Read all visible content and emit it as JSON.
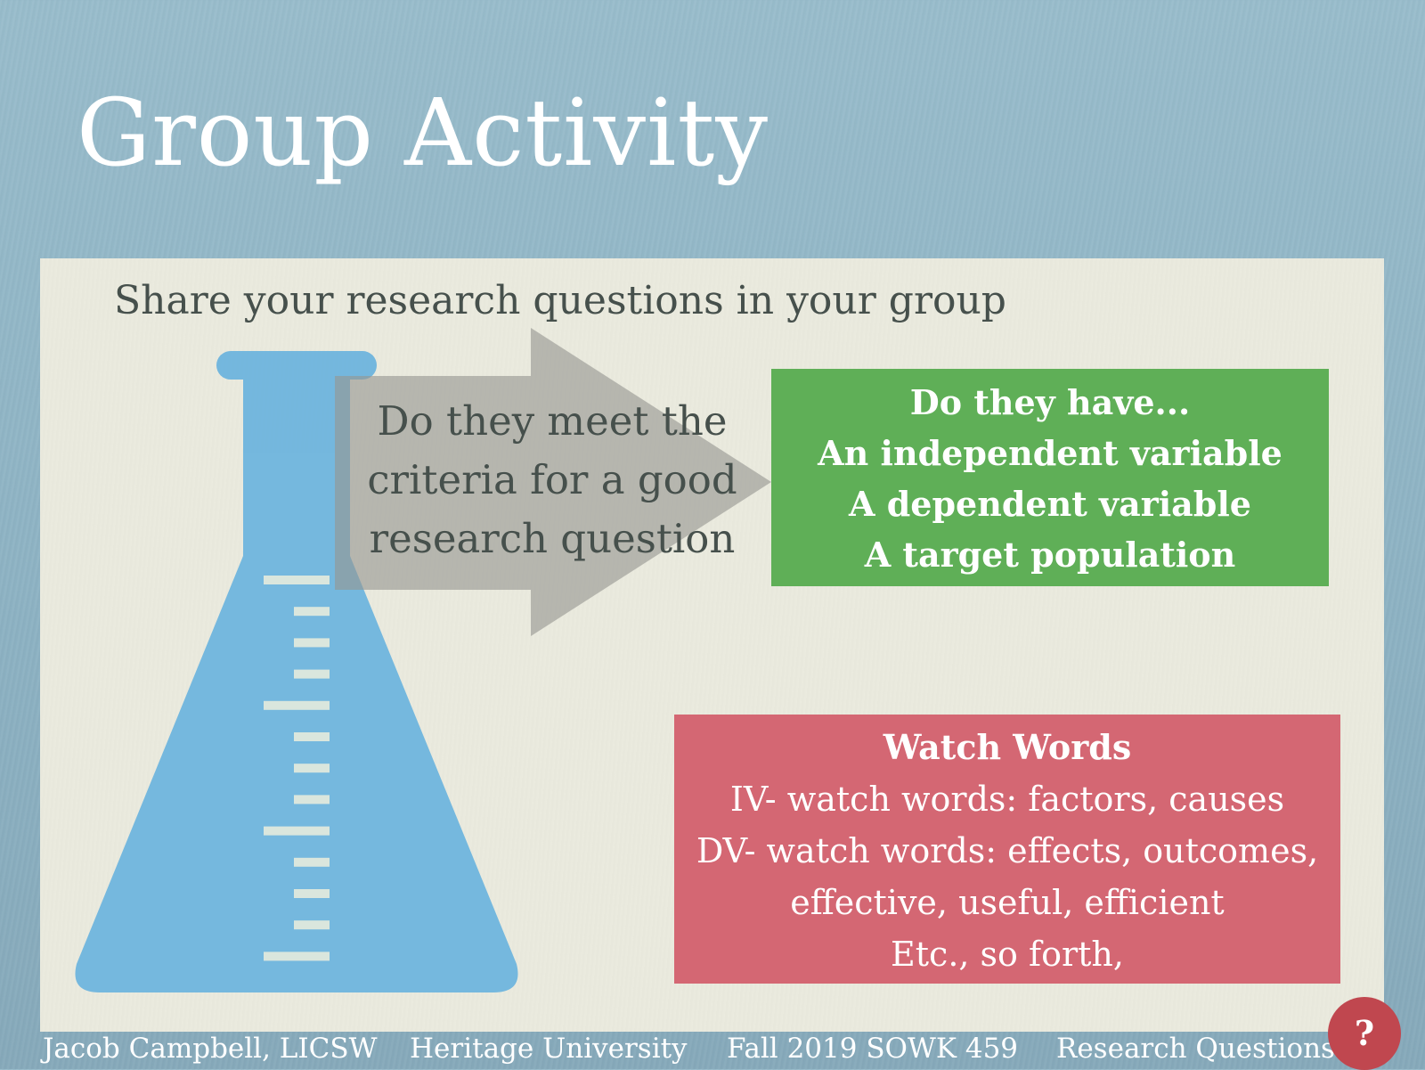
{
  "slide": {
    "title": "Group Activity",
    "subtitle": "Share your research questions in your group",
    "arrow_text": [
      "Do they meet the",
      "criteria for a good",
      "research question"
    ],
    "criteria_box": {
      "lines": [
        "Do they have...",
        "An independent variable",
        "A dependent variable",
        "A target population"
      ],
      "color": "#54aa4c"
    },
    "watch_words_box": {
      "heading": "Watch Words",
      "lines": [
        "IV- watch words: factors, causes",
        "DV- watch words: effects, outcomes,",
        "effective, useful, efficient",
        "Etc., so forth,"
      ],
      "color": "#d25c6a"
    },
    "flask_icon": "erlenmeyer-flask-icon",
    "flask_color": "#6cb4de"
  },
  "footer": {
    "author": "Jacob Campbell, LICSW",
    "institution": "Heritage University",
    "course": "Fall 2019 SOWK 459",
    "topic": "Research Questions",
    "help_label": "?"
  }
}
